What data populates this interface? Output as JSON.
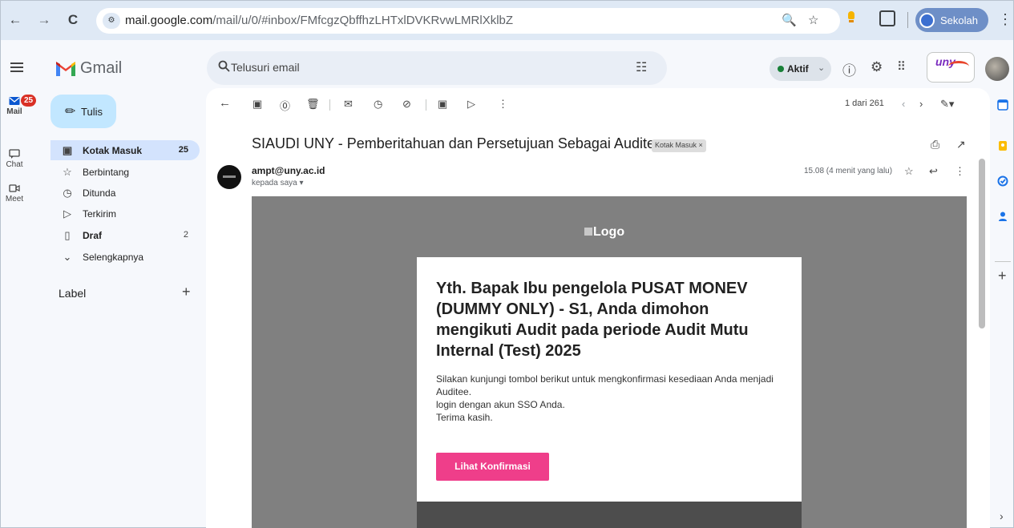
{
  "browser": {
    "back_glyph": "←",
    "forward_glyph": "→",
    "reload_glyph": "C",
    "url_host": "mail.google.com",
    "url_path": "/mail/u/0/#inbox/FMfcgzQbffhzLHTxlDVKRvwLMRlXklbZ",
    "profile_label": "Sekolah",
    "zoom_icon": "zoom-icon",
    "star_icon": "star-icon",
    "menu_glyph": "⋮"
  },
  "gmail": {
    "wordmark": "Gmail",
    "search_placeholder": "Telusuri email",
    "status_label": "Aktif",
    "status_color": "#188038",
    "brand_colors": [
      "#ea4335",
      "#fbbc04",
      "#34a853",
      "#4285f4"
    ]
  },
  "rail": {
    "mail_badge": "25",
    "items": [
      {
        "label": "Mail",
        "icon": "mail-icon"
      },
      {
        "label": "Chat",
        "icon": "chat-icon"
      },
      {
        "label": "Meet",
        "icon": "meet-icon"
      }
    ]
  },
  "sidebar": {
    "compose_label": "Tulis",
    "items": [
      {
        "label": "Kotak Masuk",
        "count": "25",
        "icon": "inbox-icon"
      },
      {
        "label": "Berbintang",
        "count": "",
        "icon": "star-icon"
      },
      {
        "label": "Ditunda",
        "count": "",
        "icon": "clock-icon"
      },
      {
        "label": "Terkirim",
        "count": "",
        "icon": "send-icon"
      },
      {
        "label": "Draf",
        "count": "2",
        "icon": "draft-icon"
      },
      {
        "label": "Selengkapnya",
        "count": "",
        "icon": "chevron-down-icon"
      }
    ],
    "labels_heading": "Label"
  },
  "toolbar": {
    "pager_text": "1 dari 261"
  },
  "email": {
    "subject": "SIAUDI UNY - Pemberitahuan dan Persetujuan Sebagai Auditee",
    "inbox_chip": "Kotak Masuk ×",
    "sender": "ampt@uny.ac.id",
    "recipient": "kepada saya",
    "time": "15.08 (4 menit yang lalu)",
    "logo_alt": "Logo",
    "heading": "Yth. Bapak Ibu pengelola PUSAT MONEV (DUMMY ONLY) - S1, Anda dimohon mengikuti Audit pada periode Audit Mutu Internal (Test) 2025",
    "body_lines": [
      "Silakan kunjungi tombol berikut untuk mengkonfirmasi kesediaan Anda menjadi Auditee.",
      "login dengan akun SSO Anda.",
      "Terima kasih."
    ],
    "button_label": "Lihat Konfirmasi",
    "button_color": "#ef3e8a"
  }
}
